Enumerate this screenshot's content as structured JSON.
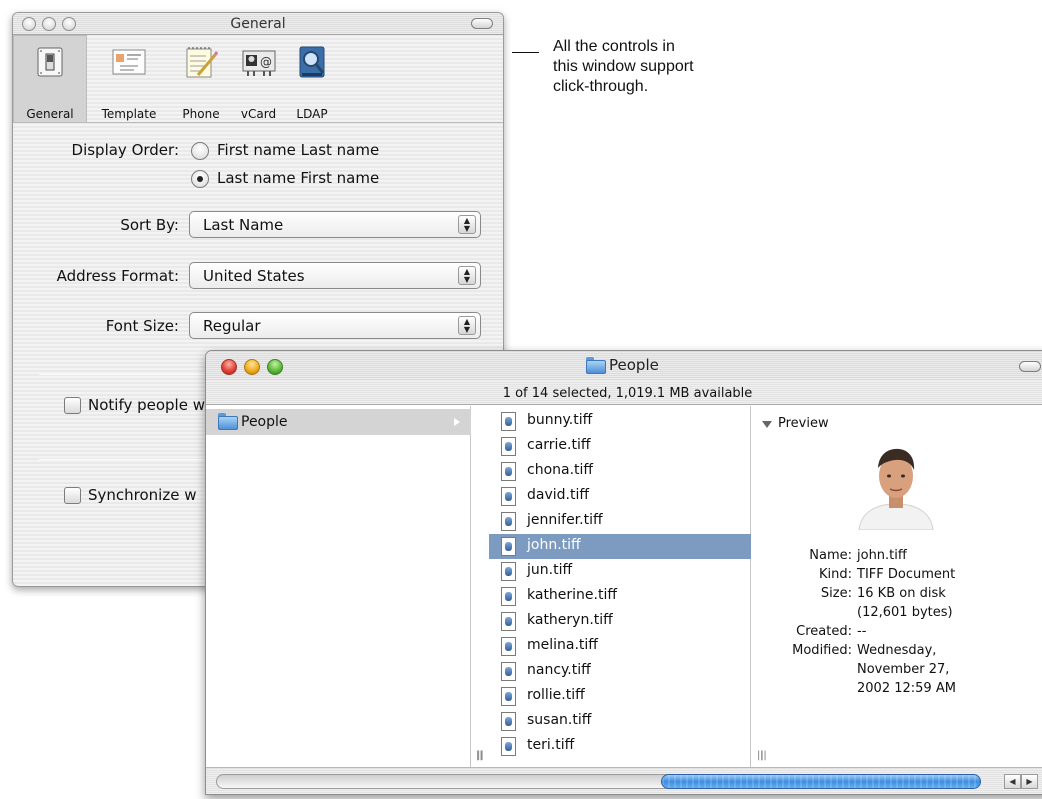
{
  "general_window": {
    "title": "General",
    "toolbar": [
      {
        "label": "General",
        "icon": "switch-icon"
      },
      {
        "label": "Template",
        "icon": "card-template-icon"
      },
      {
        "label": "Phone",
        "icon": "notepad-phone-icon"
      },
      {
        "label": "vCard",
        "icon": "vcard-icon"
      },
      {
        "label": "LDAP",
        "icon": "ldap-directory-icon"
      }
    ],
    "display_order_label": "Display Order:",
    "display_order_options": [
      "First name Last name",
      "Last name First name"
    ],
    "display_order_selected": 1,
    "sort_by_label": "Sort By:",
    "sort_by_value": "Last Name",
    "address_format_label": "Address Format:",
    "address_format_value": "United States",
    "font_size_label": "Font Size:",
    "font_size_value": "Regular",
    "notify_label": "Notify people w",
    "sync_label": "Synchronize w"
  },
  "annotation": {
    "lines": [
      "All the controls in",
      "this window support",
      "click-through."
    ]
  },
  "finder_window": {
    "title": "People",
    "status": "1 of 14 selected, 1,019.1 MB available",
    "column1_items": [
      "People"
    ],
    "files": [
      "bunny.tiff",
      "carrie.tiff",
      "chona.tiff",
      "david.tiff",
      "jennifer.tiff",
      "john.tiff",
      "jun.tiff",
      "katherine.tiff",
      "katheryn.tiff",
      "melina.tiff",
      "nancy.tiff",
      "rollie.tiff",
      "susan.tiff",
      "teri.tiff"
    ],
    "selected_file": "john.tiff",
    "preview": {
      "heading": "Preview",
      "name_label": "Name:",
      "name": "john.tiff",
      "kind_label": "Kind:",
      "kind": "TIFF Document",
      "size_label": "Size:",
      "size_line1": "16 KB on disk",
      "size_line2": "(12,601 bytes)",
      "created_label": "Created:",
      "created": "--",
      "modified_label": "Modified:",
      "modified_line1": "Wednesday,",
      "modified_line2": "November 27,",
      "modified_line3": "2002 12:59 AM"
    }
  },
  "colors": {
    "selection_blue": "#7d9bc0",
    "scroll_thumb": "#3d8ee0",
    "close_red": "#e0463a",
    "minimize_yellow": "#f0ad21",
    "zoom_green": "#5dbb3a"
  }
}
